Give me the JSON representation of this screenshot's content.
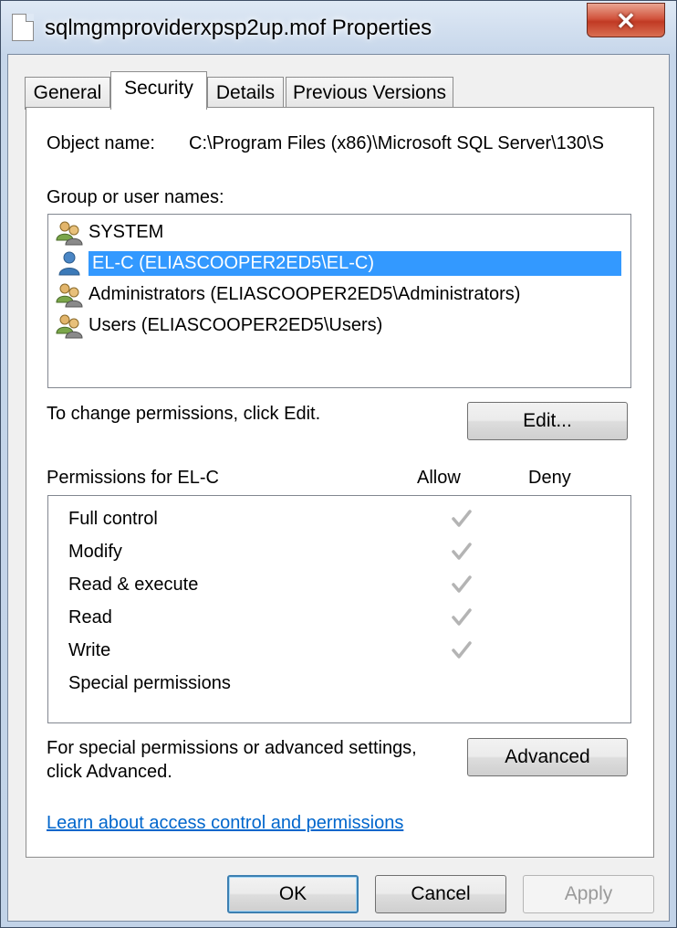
{
  "window": {
    "title": "sqlmgmproviderxpsp2up.mof Properties",
    "close_glyph": "✕",
    "close_color": "#c7432b"
  },
  "tabs": [
    {
      "label": "General",
      "active": false
    },
    {
      "label": "Security",
      "active": true
    },
    {
      "label": "Details",
      "active": false
    },
    {
      "label": "Previous Versions",
      "active": false
    }
  ],
  "security": {
    "object_name_label": "Object name:",
    "object_name_value": "C:\\Program Files (x86)\\Microsoft SQL Server\\130\\S",
    "group_label": "Group or user names:",
    "groups": [
      {
        "name": "SYSTEM",
        "icon": "users-icon",
        "selected": false
      },
      {
        "name": "EL-C (ELIASCOOPER2ED5\\EL-C)",
        "icon": "user-icon",
        "selected": true
      },
      {
        "name": "Administrators (ELIASCOOPER2ED5\\Administrators)",
        "icon": "users-icon",
        "selected": false
      },
      {
        "name": "Users (ELIASCOOPER2ED5\\Users)",
        "icon": "users-icon",
        "selected": false
      }
    ],
    "change_text": "To change permissions, click Edit.",
    "edit_button": "Edit...",
    "permissions_label": "Permissions for EL-C",
    "allow_header": "Allow",
    "deny_header": "Deny",
    "permissions": [
      {
        "name": "Full control",
        "allow": true,
        "deny": false
      },
      {
        "name": "Modify",
        "allow": true,
        "deny": false
      },
      {
        "name": "Read & execute",
        "allow": true,
        "deny": false
      },
      {
        "name": "Read",
        "allow": true,
        "deny": false
      },
      {
        "name": "Write",
        "allow": true,
        "deny": false
      },
      {
        "name": "Special permissions",
        "allow": false,
        "deny": false
      }
    ],
    "advanced_text_line1": "For special permissions or advanced settings,",
    "advanced_text_line2": "click Advanced.",
    "advanced_button": "Advanced",
    "learn_link": "Learn about access control and permissions",
    "selection_color": "#3399ff",
    "link_color": "#0066cc"
  },
  "footer": {
    "ok": "OK",
    "cancel": "Cancel",
    "apply": "Apply",
    "apply_enabled": false
  }
}
